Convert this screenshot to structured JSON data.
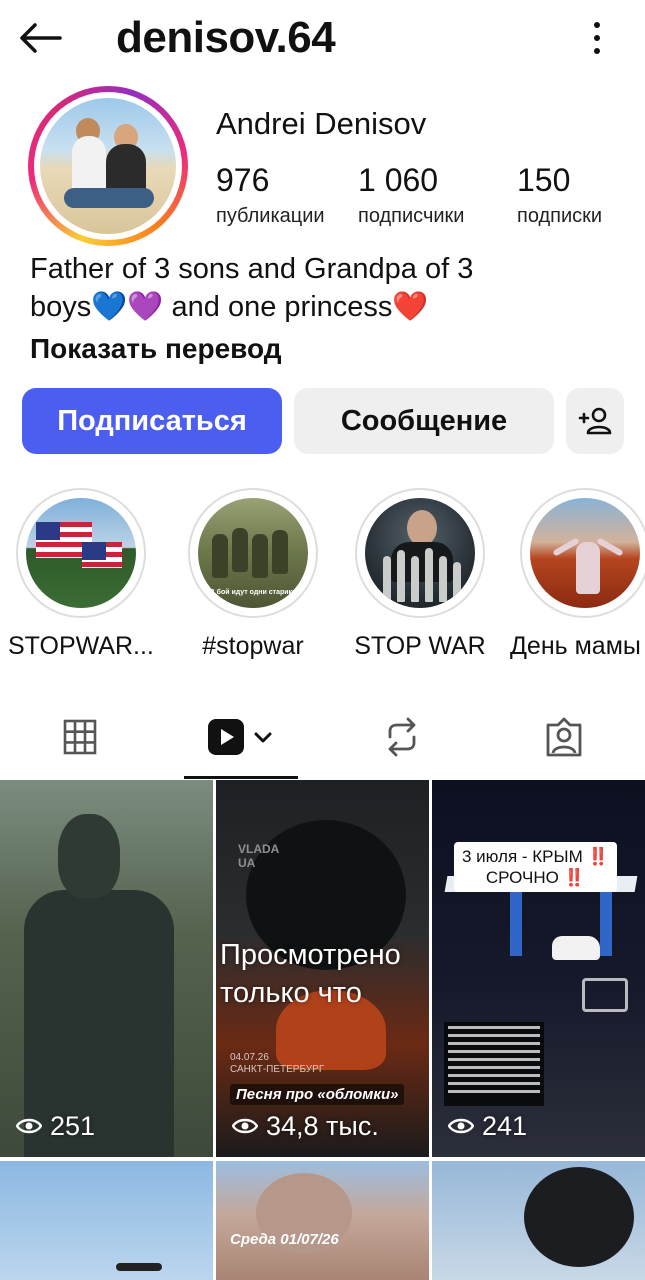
{
  "header": {
    "username": "denisov.64",
    "back_icon": "arrow-left-icon",
    "more_icon": "more-vertical-icon"
  },
  "profile": {
    "display_name": "Andrei Denisov",
    "stats": [
      {
        "value": "976",
        "label": "публикации"
      },
      {
        "value": "1 060",
        "label": "подписчики"
      },
      {
        "value": "150",
        "label": "подписки"
      }
    ],
    "bio_line1": "Father of 3 sons and Grandpa of 3",
    "bio_line2": "boys💙💜 and one princess❤️",
    "translate_label": "Показать перевод"
  },
  "actions": {
    "follow_label": "Подписаться",
    "message_label": "Сообщение",
    "add_user_icon": "add-user-icon"
  },
  "highlights": [
    {
      "label": "STOPWAR..."
    },
    {
      "label": "#stopwar",
      "caption": "В бой идут одни старики"
    },
    {
      "label": "STOP WAR"
    },
    {
      "label": "День мамы"
    }
  ],
  "tabs": {
    "grid_icon": "grid-icon",
    "reels_icon": "reels-icon",
    "reposts_icon": "repost-icon",
    "tagged_icon": "tagged-icon",
    "active": "reels"
  },
  "reels": [
    {
      "views": "251"
    },
    {
      "views": "34,8 тыс.",
      "overlay": "Просмотрено только что",
      "watermark_line1": "VLADA",
      "watermark_line2": "UA",
      "date_line1": "04.07.26",
      "date_line2": "САНКТ-ПЕТЕРБУРГ",
      "song": "Песня про «обломки»"
    },
    {
      "views": "241",
      "headline_line1": "3 июля - КРЫМ",
      "headline_line2": "СРОЧНО",
      "alert_mark": "‼️"
    },
    {
      "views": ""
    },
    {
      "views": "",
      "date_label": "Среда 01/07/26"
    },
    {
      "views": ""
    }
  ],
  "colors": {
    "follow_button": "#4c5eef",
    "secondary_button": "#efefef",
    "alert_red": "#e11f1f"
  }
}
